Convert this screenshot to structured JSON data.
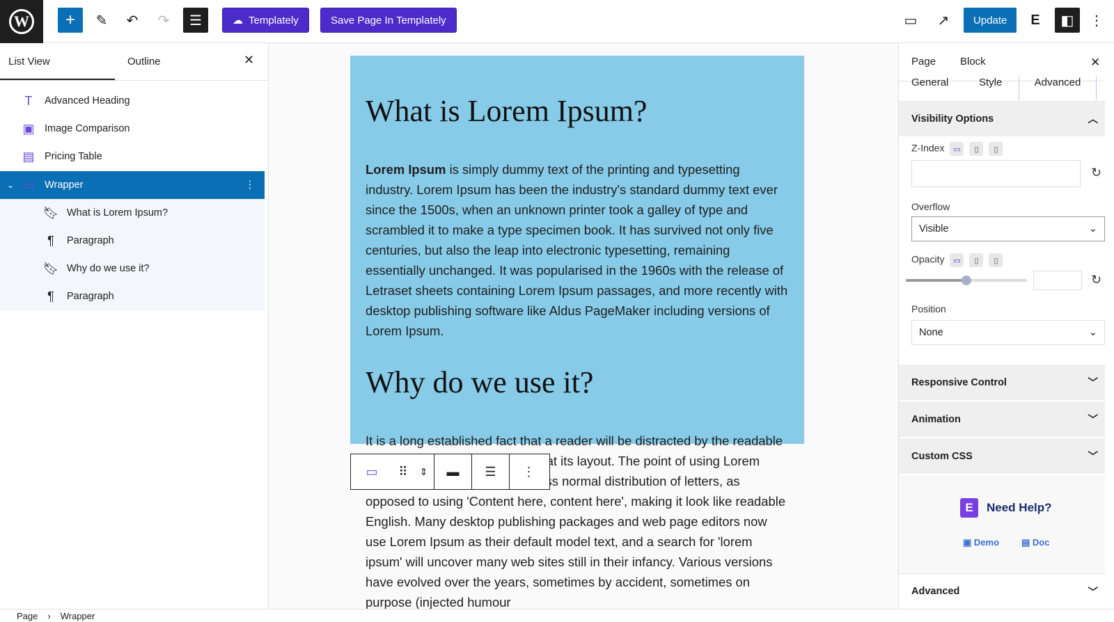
{
  "topbar": {
    "templately": "Templately",
    "save_templately": "Save Page In Templately",
    "update": "Update"
  },
  "left": {
    "tabs": [
      "List View",
      "Outline"
    ],
    "items": [
      {
        "label": "Advanced Heading",
        "icon": "heading-icon"
      },
      {
        "label": "Image Comparison",
        "icon": "image-compare-icon"
      },
      {
        "label": "Pricing Table",
        "icon": "pricing-table-icon"
      },
      {
        "label": "Wrapper",
        "icon": "wrapper-icon"
      },
      {
        "label": "What is Lorem Ipsum?",
        "icon": "bookmark-icon"
      },
      {
        "label": "Paragraph",
        "icon": "paragraph-icon"
      },
      {
        "label": "Why do we use it?",
        "icon": "bookmark-icon"
      },
      {
        "label": "Paragraph",
        "icon": "paragraph-icon"
      }
    ]
  },
  "content": {
    "h1": "What is Lorem Ipsum?",
    "p1_bold": "Lorem Ipsum",
    "p1": " is simply dummy text of the printing and typesetting industry. Lorem Ipsum has been the industry's standard dummy text ever since the 1500s, when an unknown printer took a galley of type and scrambled it to make a type specimen book. It has survived not only five centuries, but also the leap into electronic typesetting, remaining essentially unchanged. It was popularised in the 1960s with the release of Letraset sheets containing Lorem Ipsum passages, and more recently with desktop publishing software like Aldus PageMaker including versions of Lorem Ipsum.",
    "h2": "Why do we use it?",
    "p2": "It is a long established fact that a reader will be distracted by the readable content of a page when looking at its layout. The point of using Lorem Ipsum is that it has a more-or-less normal distribution of letters, as opposed to using 'Content here, content here', making it look like readable English. Many desktop publishing packages and web page editors now use Lorem Ipsum as their default model text, and a search for 'lorem ipsum' will uncover many web sites still in their infancy. Various versions have evolved over the years, sometimes by accident, sometimes on purpose (injected humour"
  },
  "right": {
    "tabs": [
      "Page",
      "Block"
    ],
    "subtabs": [
      "General",
      "Style",
      "Advanced"
    ],
    "visibility": "Visibility Options",
    "zindex": "Z-Index",
    "overflow_label": "Overflow",
    "overflow": "Visible",
    "opacity_label": "Opacity",
    "opacity_percent": 50,
    "position_label": "Position",
    "position": "None",
    "sections": [
      "Responsive Control",
      "Animation",
      "Custom CSS"
    ],
    "help": "Need Help?",
    "demo": "Demo",
    "doc": "Doc",
    "advanced": "Advanced"
  },
  "breadcrumb": [
    "Page",
    "Wrapper"
  ],
  "colors": {
    "accent": "#0a6fb4",
    "templately": "#4b2bc9",
    "wrapper_bg": "#87cbe8"
  }
}
